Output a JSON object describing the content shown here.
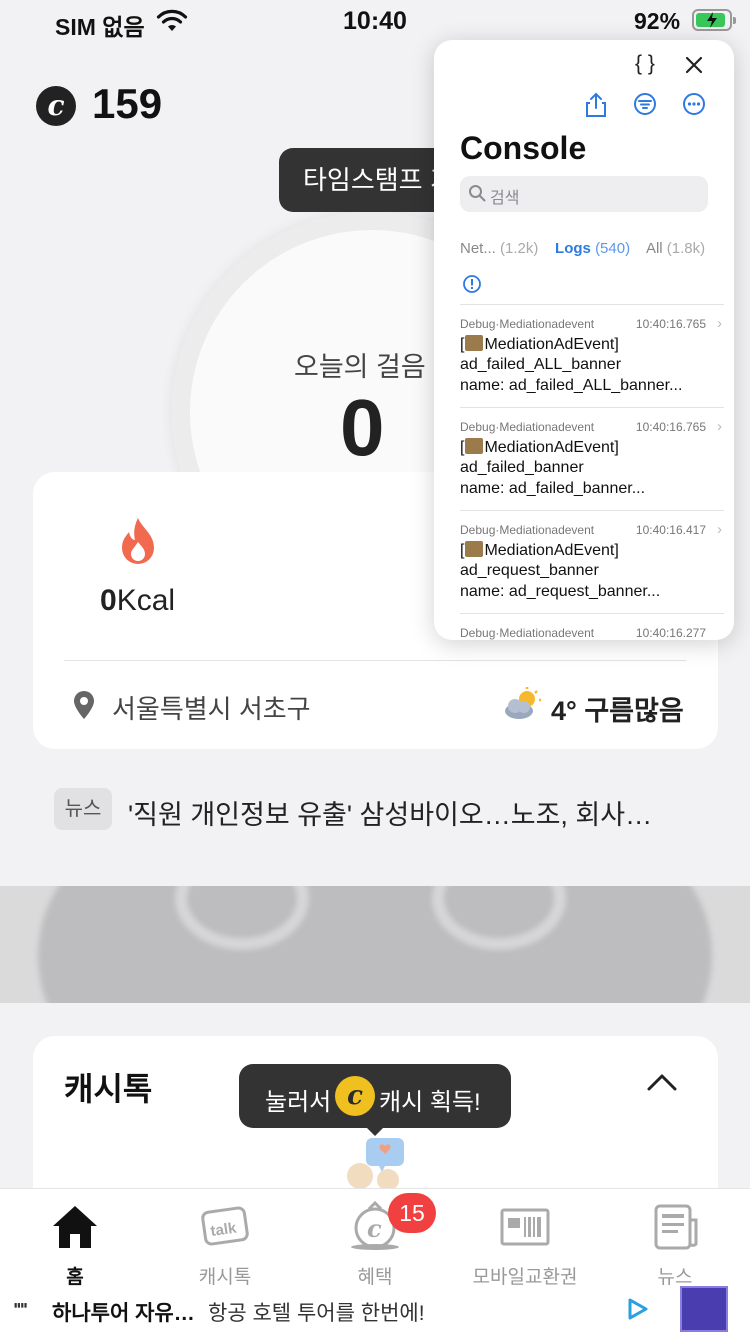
{
  "status_bar": {
    "carrier": "SIM 없음",
    "time": "10:40",
    "battery_pct": "92%",
    "battery_level": 0.92
  },
  "header": {
    "coin_symbol": "c",
    "coin_count": "159"
  },
  "tooltip_timestamp": "타임스탬프 기",
  "steps": {
    "label": "오늘의 걸음 수",
    "value": "0"
  },
  "card": {
    "kcal_value": "0",
    "kcal_unit": "Kcal",
    "location": "서울특별시 서초구",
    "weather": "4° 구름많음"
  },
  "news": {
    "badge": "뉴스",
    "headline": "'직원 개인정보 유출' 삼성바이오…노조, 회사…"
  },
  "cashtalk": {
    "title": "캐시톡",
    "tooltip_before": "눌러서",
    "tooltip_coin": "c",
    "tooltip_after": "캐시 획득!"
  },
  "tabs": [
    {
      "label": "홈",
      "icon": "home-icon",
      "active": true
    },
    {
      "label": "캐시톡",
      "icon": "talk-icon",
      "active": false
    },
    {
      "label": "혜택",
      "icon": "benefit-coin-icon",
      "active": false
    },
    {
      "label": "모바일교환권",
      "icon": "voucher-icon",
      "active": false
    },
    {
      "label": "뉴스",
      "icon": "news-icon",
      "active": false
    }
  ],
  "benefit_badge": "15",
  "ad": {
    "title": "하나투어 자유…",
    "desc": "항공 호텔 투어를 한번에!"
  },
  "console": {
    "braces": "{ }",
    "title": "Console",
    "search_placeholder": "검색",
    "tabs": [
      {
        "label": "Net...",
        "count": "(1.2k)"
      },
      {
        "label": "Logs",
        "count": "(540)"
      },
      {
        "label": "All",
        "count": "(1.8k)"
      }
    ],
    "entries": [
      {
        "source": "Debug·Mediationadevent",
        "time": "10:40:16.765",
        "line1": "MediationAdEvent]",
        "line2": "ad_failed_ALL_banner",
        "line3": "name: ad_failed_ALL_banner..."
      },
      {
        "source": "Debug·Mediationadevent",
        "time": "10:40:16.765",
        "line1": "MediationAdEvent]",
        "line2": "ad_failed_banner",
        "line3": "name: ad_failed_banner..."
      },
      {
        "source": "Debug·Mediationadevent",
        "time": "10:40:16.417",
        "line1": "MediationAdEvent]",
        "line2": "ad_request_banner",
        "line3": "name: ad_request_banner..."
      },
      {
        "source": "Debug·Mediationadevent",
        "time": "10:40:16.277",
        "line1": "",
        "line2": "",
        "line3": ""
      }
    ]
  }
}
